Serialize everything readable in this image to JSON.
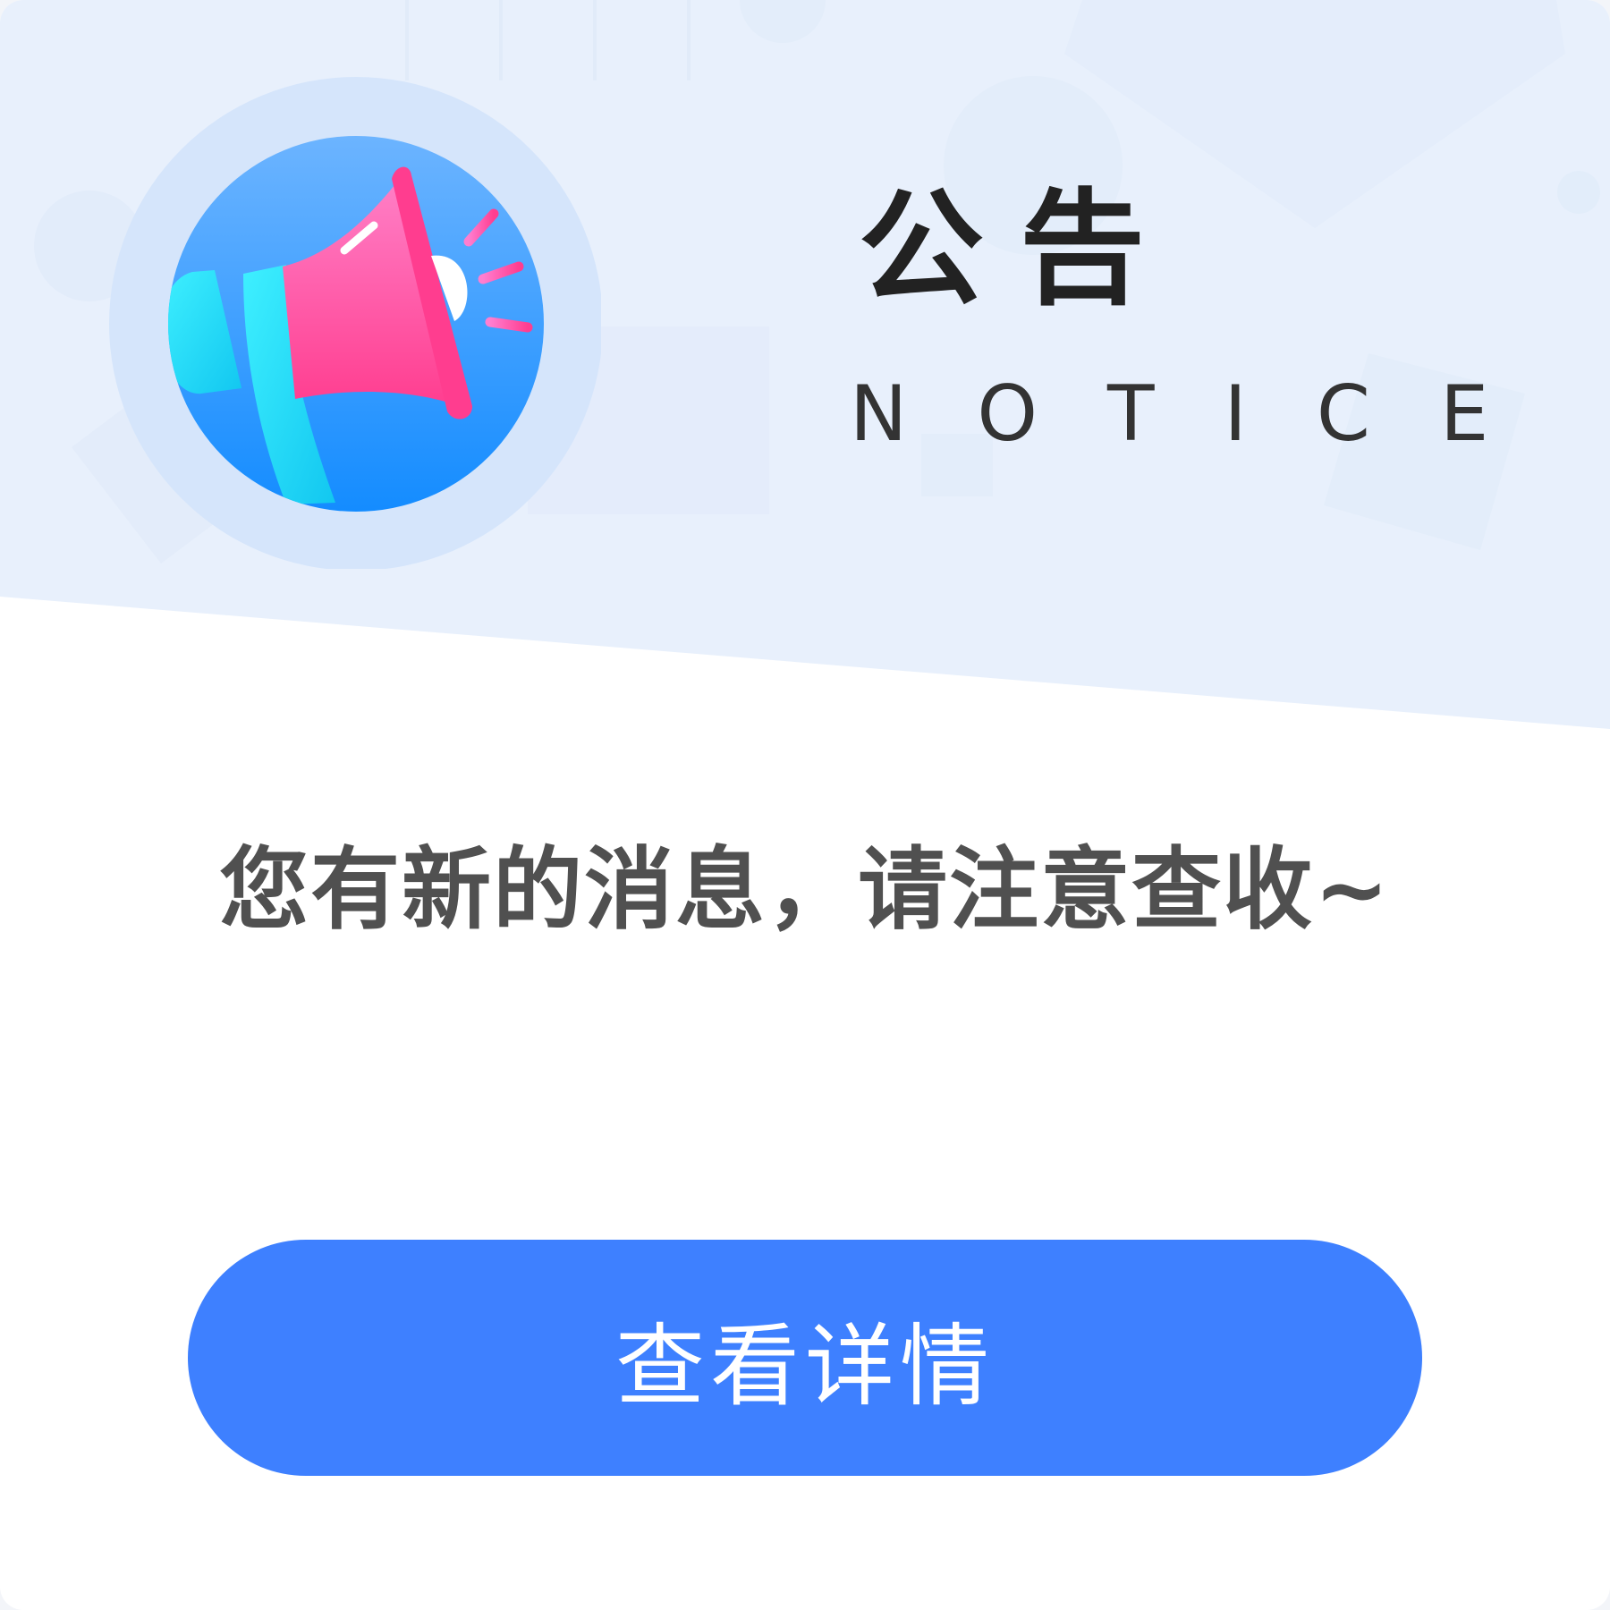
{
  "notice": {
    "title_cn": "公告",
    "title_en": "NOTICE",
    "message": "您有新的消息，请注意查收~",
    "button_label": "查看详情"
  },
  "icon": {
    "name": "megaphone-icon"
  },
  "colors": {
    "header_background": "#e8f0fc",
    "card_background": "#ffffff",
    "button": "#3e80ff",
    "title_cn": "#222222",
    "title_en": "#333333",
    "message": "#505050",
    "megaphone_body": "#ff4d94",
    "megaphone_handle": "#22dcf5",
    "icon_circle": "#1e90ff"
  }
}
